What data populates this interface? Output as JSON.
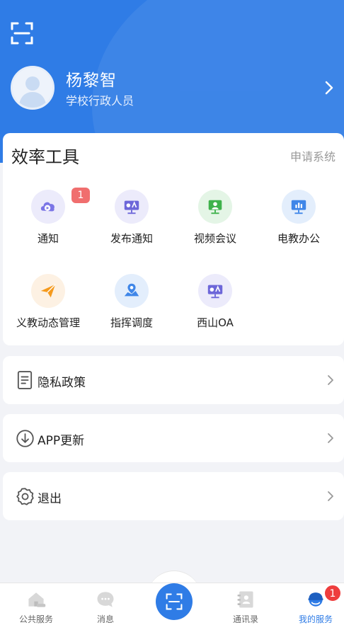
{
  "profile": {
    "name": "杨黎智",
    "role": "学校行政人员"
  },
  "tools": {
    "title": "效率工具",
    "apply_link": "申请系统",
    "items": [
      {
        "label": "通知",
        "icon": "notification-play-icon",
        "badge": "1"
      },
      {
        "label": "发布通知",
        "icon": "publish-board-icon"
      },
      {
        "label": "视频会议",
        "icon": "video-meeting-icon"
      },
      {
        "label": "电教办公",
        "icon": "monitor-chart-icon"
      },
      {
        "label": "义教动态管理",
        "icon": "paper-plane-icon"
      },
      {
        "label": "指挥调度",
        "icon": "map-pin-icon"
      },
      {
        "label": "西山OA",
        "icon": "oa-board-icon"
      }
    ]
  },
  "settings": {
    "privacy_label": "隐私政策",
    "update_label": "APP更新",
    "logout_label": "退出"
  },
  "tabbar": {
    "items": [
      {
        "label": "公共服务",
        "icon": "home-icon"
      },
      {
        "label": "消息",
        "icon": "chat-icon"
      },
      {
        "label": "通讯录",
        "icon": "contacts-icon"
      },
      {
        "label": "我的服务",
        "icon": "user-helmet-icon"
      }
    ],
    "active_tab": "我的服务",
    "my_service_badge": "1"
  },
  "colors": {
    "primary": "#2f7ce6",
    "badge": "#ee3d3d",
    "page_bg": "#f2f3f7"
  }
}
